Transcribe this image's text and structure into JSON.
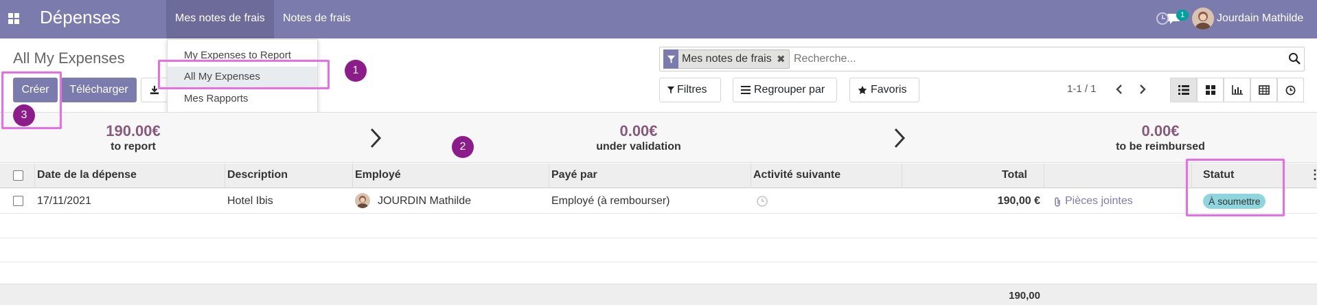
{
  "navbar": {
    "app_title": "Dépenses",
    "menus": [
      "Mes notes de frais",
      "Notes de frais"
    ],
    "chat_count": "1",
    "user_name": "Jourdain Mathilde",
    "color": "#7c7bad"
  },
  "dropdown": {
    "items": [
      "My Expenses to Report",
      "All My Expenses",
      "Mes Rapports"
    ]
  },
  "control_panel": {
    "title": "All My Expenses",
    "create_label": "Créer",
    "upload_label": "Télécharger",
    "filter_facet": "Mes notes de frais",
    "search_placeholder": "Recherche...",
    "filters_label": "Filtres",
    "groupby_label": "Regrouper par",
    "favorites_label": "Favoris",
    "pager": "1-1 / 1"
  },
  "annotations": [
    "1",
    "2",
    "3"
  ],
  "stats": [
    {
      "value": "190.00€",
      "label": "to report",
      "color": "#875a7b"
    },
    {
      "value": "0.00€",
      "label": "under validation",
      "color": "#875a7b"
    },
    {
      "value": "0.00€",
      "label": "to be reimbursed",
      "color": "#875a7b"
    }
  ],
  "table": {
    "headers": [
      "Date de la dépense",
      "Description",
      "Employé",
      "Payé par",
      "Activité suivante",
      "Total",
      "Statut"
    ],
    "rows": [
      {
        "date": "17/11/2021",
        "description": "Hotel Ibis",
        "employee": "JOURDIN Mathilde",
        "paid_by": "Employé (à rembourser)",
        "total": "190,00 €",
        "attachments": "Pièces jointes",
        "status": "À soumettre",
        "status_color": "#8fd5dd"
      }
    ],
    "footer_total": "190,00"
  }
}
